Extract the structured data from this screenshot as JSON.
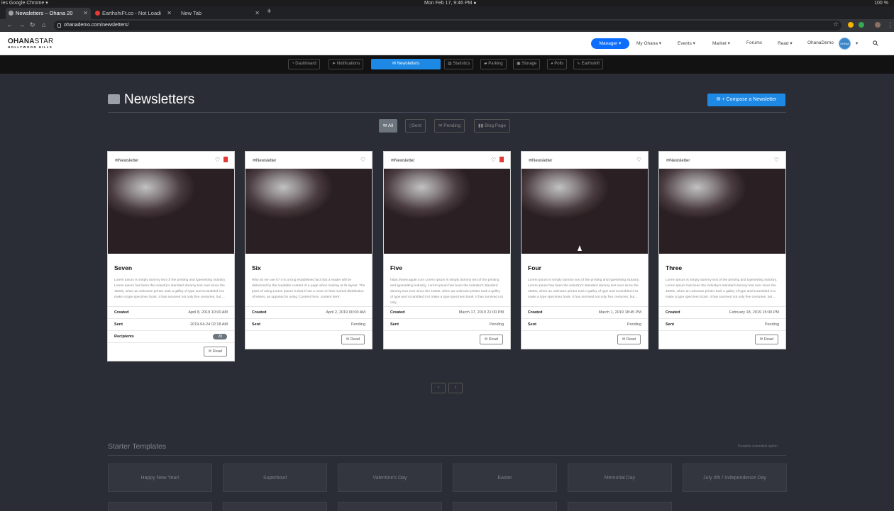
{
  "os": {
    "left": "ies  Google Chrome ▾",
    "clock": "Mon Feb 17,  9:46 PM ●",
    "tray": "100 %"
  },
  "browser": {
    "tabs": [
      {
        "label": "Newsletters – Ohana 20"
      },
      {
        "label": "EarthshiFt.co - Not Loadi"
      },
      {
        "label": "New Tab"
      }
    ],
    "url": "ohanademo.com/newsletters/"
  },
  "header": {
    "logo_main_a": "OHANA",
    "logo_main_b": "STAR",
    "logo_sub": "HOLLYWOOD HILLS",
    "nav": {
      "manager": "Manager ▾",
      "my_ohana": "My Ohana ▾",
      "events": "Events ▾",
      "market": "Market ▾",
      "forums": "Forums",
      "read": "Read ▾",
      "user": "OhanaDemo"
    },
    "avatar_text": "OHANA STAR"
  },
  "subnav": [
    {
      "label": "Dashboard",
      "icon": "dashboard-icon"
    },
    {
      "label": "Notifications",
      "icon": "send-icon"
    },
    {
      "label": "Newsletters",
      "icon": "envelope-icon"
    },
    {
      "label": "Statistics",
      "icon": "chart-icon"
    },
    {
      "label": "Parking",
      "icon": "car-icon"
    },
    {
      "label": "Storage",
      "icon": "box-icon"
    },
    {
      "label": "Polls",
      "icon": "pie-icon"
    },
    {
      "label": "Earthshift",
      "icon": "wave-icon"
    }
  ],
  "page": {
    "title": "Newsletters",
    "compose": "+ Compose a Newsletter",
    "filters": [
      {
        "label": "All"
      },
      {
        "label": "Sent"
      },
      {
        "label": "Pending"
      },
      {
        "label": "Blog Page"
      }
    ]
  },
  "cards": [
    {
      "tag": "Newsletter",
      "bookmarked": true,
      "title": "Seven",
      "text": "Lorem Ipsum is simply dummy text of the printing and typesetting industry. Lorem Ipsum has been the industry's standard dummy text ever since the 1500s, when an unknown printer took a galley of type and scrambled it to make a type specimen book. It has survived not only five centuries, but ...",
      "created_label": "Created",
      "created": "April 8, 2019 10:00 AM",
      "sent_label": "Sent",
      "sent": "2019-04-24 02:18 AM",
      "recipients_label": "Recipients",
      "recipients": "28",
      "read": "Read"
    },
    {
      "tag": "Newsletter",
      "bookmarked": false,
      "title": "Six",
      "text": "Why do we use it? It is a long established fact that a reader will be distracted by the readable content of a page when looking at its layout. The point of using Lorem Ipsum is that it has a more-or-less normal distribution of letters, as opposed to using 'Content here, content here',",
      "created_label": "Created",
      "created": "April 2, 2019 00:00 AM",
      "sent_label": "Sent",
      "sent": "Pending",
      "read": "Read"
    },
    {
      "tag": "Newsletter",
      "bookmarked": true,
      "title": "Five",
      "text": "https://www.apple.com Lorem Ipsum is simply dummy text of the printing and typesetting industry. Lorem Ipsum has been the industry's standard dummy text ever since the 1500s, when an unknown printer took a galley of type and scrambled it to make a type specimen book. It has survived not only",
      "created_label": "Created",
      "created": "March 17, 2019 21:00 PM",
      "sent_label": "Sent",
      "sent": "Pending",
      "read": "Read"
    },
    {
      "tag": "Newsletter",
      "bookmarked": false,
      "title": "Four",
      "text": "Lorem Ipsum is simply dummy text of the printing and typesetting industry. Lorem Ipsum has been the industry's standard dummy text ever since the 1500s, when an unknown printer took a galley of type and scrambled it to make a type specimen book. It has survived not only five centuries, but ...",
      "created_label": "Created",
      "created": "March 1, 2019 18:45 PM",
      "sent_label": "Sent",
      "sent": "Pending",
      "read": "Read"
    },
    {
      "tag": "Newsletter",
      "bookmarked": false,
      "title": "Three",
      "text": "Lorem Ipsum is simply dummy text of the printing and typesetting industry. Lorem Ipsum has been the industry's standard dummy text ever since the 1500s, when an unknown printer took a galley of type and scrambled it to make a type specimen book. It has survived not only five centuries, but ...",
      "created_label": "Created",
      "created": "February 18, 2019 15:00 PM",
      "sent_label": "Sent",
      "sent": "Pending",
      "read": "Read"
    }
  ],
  "pager": {
    "prev": "‹",
    "next": "›"
  },
  "templates": {
    "title": "Starter Templates",
    "note": "Possible extended option",
    "items": [
      "Happy New Year!",
      "Superbowl",
      "Valentine's Day",
      "Easter",
      "Memorial Day",
      "July 4th / Independence Day"
    ]
  },
  "colors": {
    "accent": "#1e88e5",
    "background": "#2a2d35",
    "bookmark": "#e53935"
  }
}
